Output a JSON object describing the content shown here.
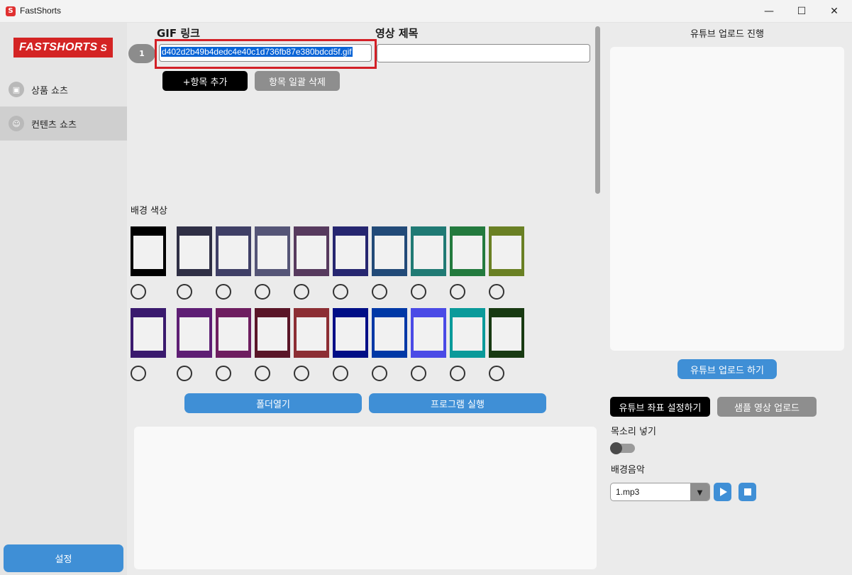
{
  "window": {
    "title": "FastShorts",
    "minimize_glyph": "—",
    "maximize_glyph": "☐",
    "close_glyph": "✕"
  },
  "sidebar": {
    "logo_text": "FASTSHORTS",
    "items": [
      {
        "label": "상품 쇼츠",
        "icon": "bag-icon",
        "active": false
      },
      {
        "label": "컨텐츠 쇼츠",
        "icon": "smile-icon",
        "active": true
      }
    ],
    "settings_label": "설정"
  },
  "main": {
    "gif_link_label": "GIF 링크",
    "video_title_label": "영상 제목",
    "row_number": "1",
    "gif_link_value": "d402d2b49b4dedc4e40c1d736fb87e380bdcd5f.gif",
    "video_title_value": "",
    "add_item_label": "+항목 추가",
    "delete_all_label": "항목 일괄 삭제",
    "bg_color_label": "배경 색상",
    "bg_colors_row1": [
      "#000000",
      "#2f2f45",
      "#3f3f66",
      "#555577",
      "#573a5e",
      "#262670",
      "#224a78",
      "#207a74",
      "#237a3e",
      "#6a8024"
    ],
    "bg_colors_row2": [
      "#3a1a6e",
      "#5e1e74",
      "#6e1e60",
      "#5a1628",
      "#8c2e34",
      "#000e86",
      "#0038a6",
      "#4a4ae6",
      "#0a9a9a",
      "#183a12"
    ],
    "open_folder_label": "폴더열기",
    "run_program_label": "프로그램 실행"
  },
  "right": {
    "upload_progress_title": "유튜브 업로드 진행",
    "upload_button_label": "유튜브 업로드 하기",
    "coord_setting_label": "유튜브 좌표 설정하기",
    "sample_upload_label": "샘플 영상 업로드",
    "voice_label": "목소리 넣기",
    "voice_enabled": false,
    "bgm_label": "배경음악",
    "bgm_selected": "1.mp3"
  }
}
